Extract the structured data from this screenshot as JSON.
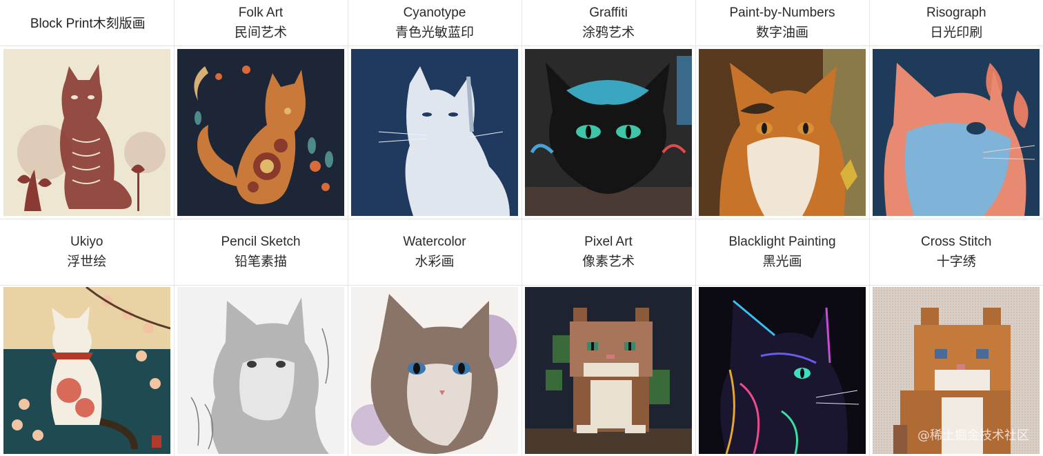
{
  "row1": [
    {
      "en": "Block Print",
      "zh": "木刻版画",
      "inline": true
    },
    {
      "en": "Folk Art",
      "zh": "民间艺术"
    },
    {
      "en": "Cyanotype",
      "zh": "青色光敏蓝印"
    },
    {
      "en": "Graffiti",
      "zh": "涂鸦艺术"
    },
    {
      "en": "Paint-by-Numbers",
      "zh": "数字油画"
    },
    {
      "en": "Risograph",
      "zh": "日光印刷"
    }
  ],
  "row2": [
    {
      "en": "Ukiyo",
      "zh": "浮世绘"
    },
    {
      "en": "Pencil Sketch",
      "zh": "铅笔素描"
    },
    {
      "en": "Watercolor",
      "zh": "水彩画"
    },
    {
      "en": "Pixel Art",
      "zh": "像素艺术"
    },
    {
      "en": "Blacklight Painting",
      "zh": "黑光画"
    },
    {
      "en": "Cross Stitch",
      "zh": "十字绣"
    }
  ],
  "watermark": "@稀土掘金技术社区",
  "palette": {
    "block_print_bg": "#ede6d0",
    "block_print_ink": "#8a3a32",
    "folk_bg": "#1c2636",
    "cyanotype_bg": "#1f3a5e",
    "graffiti_bg": "#2a2a2a",
    "paint_bg": "#5a3a1e",
    "riso_bg": "#1e3b5a",
    "ukiyo_bg": "#1f4a52",
    "pencil_bg": "#f2f2f2",
    "watercolor_bg": "#f4f1ee",
    "pixel_bg": "#1d2330",
    "blacklight_bg": "#0c0a12",
    "cross_stitch_bg": "#d9cfc6"
  }
}
